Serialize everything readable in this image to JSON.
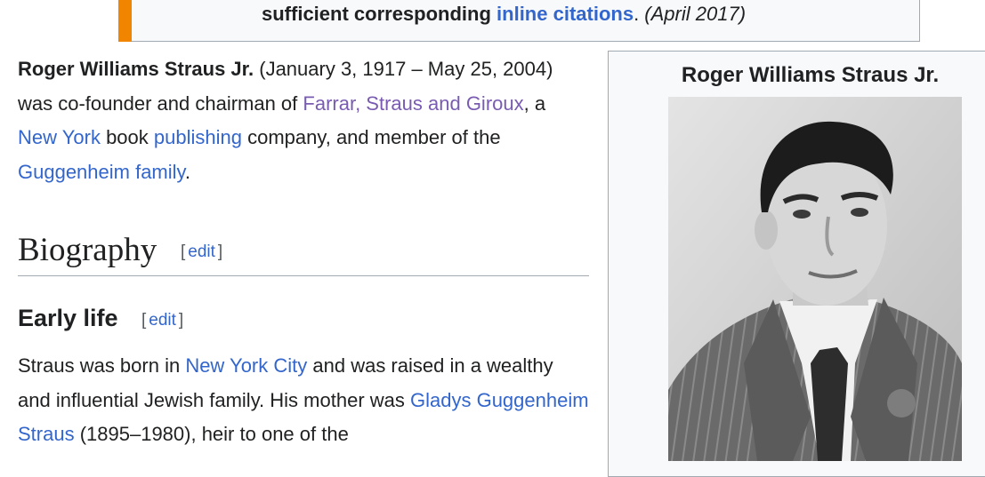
{
  "notice": {
    "text_bold_before": "sufficient corresponding ",
    "link": "inline citations",
    "text_after": ". ",
    "date": "(April 2017)"
  },
  "lead": {
    "name": "Roger Williams Straus Jr.",
    "t1": " (January 3, 1917 – May 25, 2004) was co-founder and chairman of ",
    "link_fsg": "Farrar, Straus and Giroux",
    "t2": ", a ",
    "link_ny": "New York",
    "t3": " book ",
    "link_publishing": "publishing",
    "t4": " company, and member of the ",
    "link_guggenheim": "Guggenheim family",
    "t5": "."
  },
  "biography": {
    "heading": "Biography",
    "edit_open": "[",
    "edit_label": "edit",
    "edit_close": "]"
  },
  "early_life": {
    "heading": "Early life",
    "edit_open": "[",
    "edit_label": "edit",
    "edit_close": "]",
    "t1": "Straus was born in ",
    "link_nyc": "New York City",
    "t2": " and was raised in a wealthy and influential Jewish family. His mother was ",
    "link_gladys": "Gladys Guggenheim Straus",
    "t3": " (1895–1980), heir to one of the"
  },
  "infobox": {
    "title": "Roger Williams Straus Jr."
  },
  "colors": {
    "link": "#3366cc",
    "visited_link": "#795cb2",
    "notice_bar": "#f28500"
  }
}
